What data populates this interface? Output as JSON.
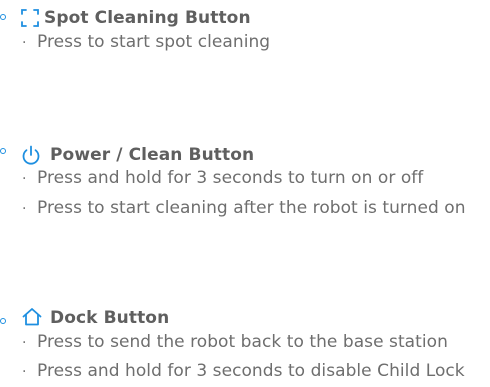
{
  "sections": [
    {
      "icon": "spot-cleaning-icon",
      "title": "Spot Cleaning Button",
      "bullets": [
        "Press to start spot cleaning"
      ]
    },
    {
      "icon": "power-icon",
      "title": "Power / Clean Button",
      "bullets": [
        "Press and hold for 3 seconds to turn on or off",
        "Press to start cleaning after the robot is turned on"
      ]
    },
    {
      "icon": "home-icon",
      "title": "Dock Button",
      "bullets": [
        "Press to send the robot back to the base station",
        "Press and hold for 3 seconds to disable Child Lock"
      ]
    }
  ],
  "bullet_mark": "·",
  "colors": {
    "accent": "#1e8fe0",
    "title": "#5f5f5f",
    "text": "#6e6e6e"
  }
}
